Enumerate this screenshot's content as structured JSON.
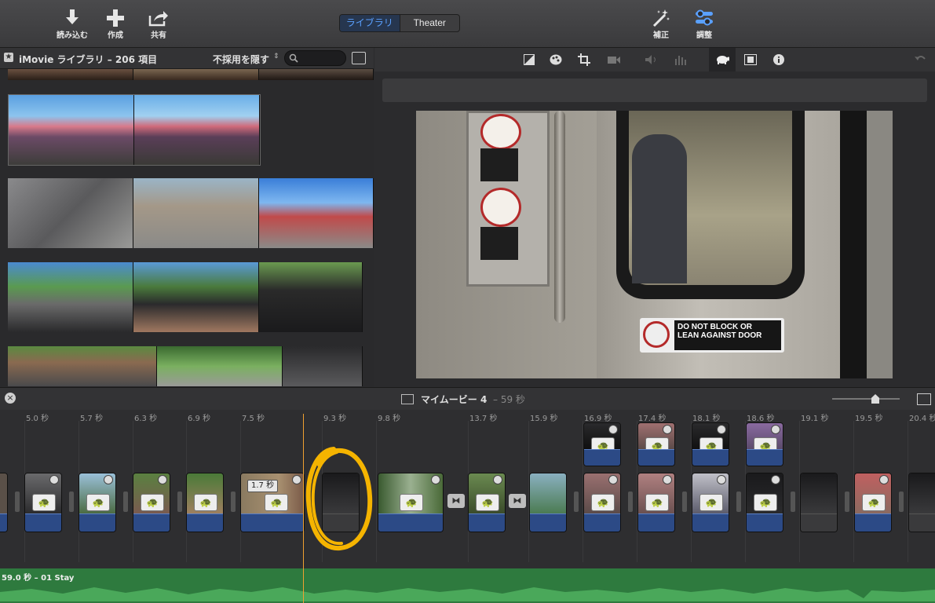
{
  "toolbar": {
    "import_label": "読み込む",
    "create_label": "作成",
    "share_label": "共有",
    "library_tab": "ライブラリ",
    "theater_tab": "Theater",
    "enhance_label": "補正",
    "adjust_label": "調整"
  },
  "library": {
    "title": "iMovie ライブラリ – 206 項目",
    "hide_rejected": "不採用を隠す"
  },
  "project": {
    "title": "マイムービー 4",
    "duration": "– 59 秒"
  },
  "timeline": {
    "ticks": [
      "5.0 秒",
      "5.7 秒",
      "6.3 秒",
      "6.9 秒",
      "7.5 秒",
      "9.3 秒",
      "9.8 秒",
      "13.7 秒",
      "15.9 秒",
      "16.9 秒",
      "17.4 秒",
      "18.1 秒",
      "18.6 秒",
      "19.1 秒",
      "19.5 秒",
      "20.4 秒"
    ],
    "clip_duration_badge": "1.7 秒",
    "audio_label": "59.0 秒 – 01 Stay"
  },
  "preview": {
    "sign_line1": "DO NOT BLOCK OR",
    "sign_line2": "LEAN AGAINST DOOR"
  },
  "colors": {
    "accent": "#5aa0ff",
    "playhead": "#f0a030",
    "annotation": "#f5b400",
    "audio_track": "#2e7a3e",
    "clip_bar": "#2c4a86"
  }
}
